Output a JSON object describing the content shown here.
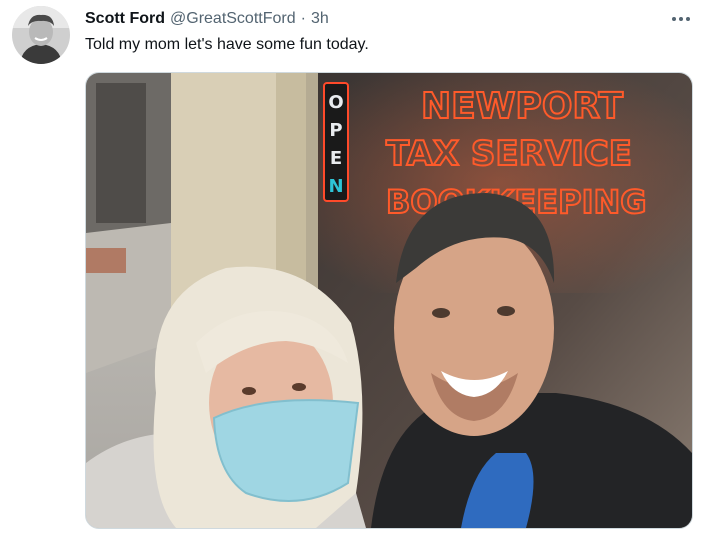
{
  "tweet": {
    "author_name": "Scott Ford",
    "handle": "@GreatScottFord",
    "separator": "·",
    "time": "3h",
    "text": "Told my mom let's have some fun today.",
    "more_icon": "more-horizontal-icon"
  },
  "photo": {
    "sign_open": [
      "O",
      "P",
      "E",
      "N"
    ],
    "neon_line1": "NEWPORT",
    "neon_line2": "TAX SERVICE",
    "neon_line3": "BOOKKEEPING",
    "neon_color": "#ff5a2a"
  }
}
